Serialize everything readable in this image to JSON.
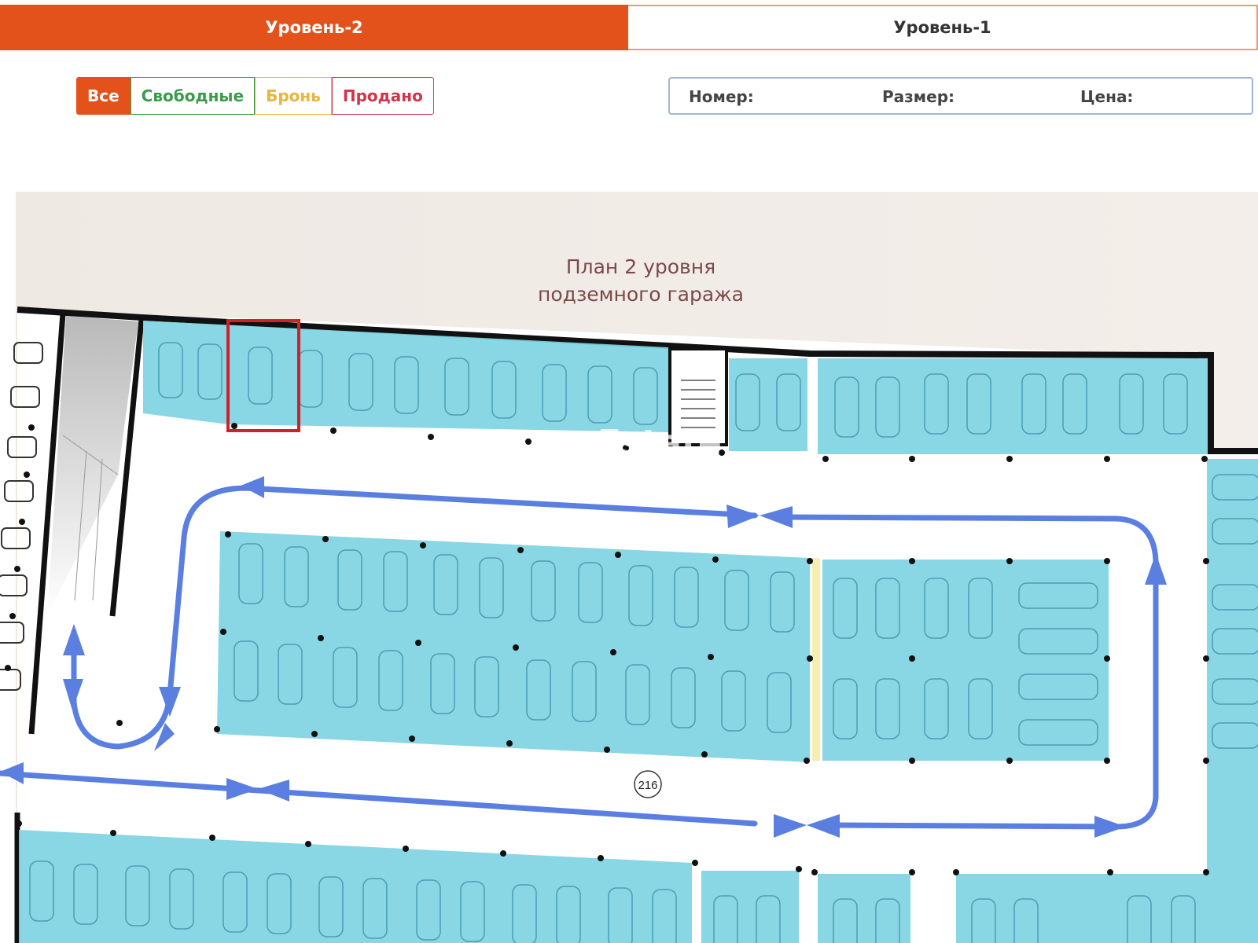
{
  "levels": {
    "active": "Уровень-2",
    "inactive": "Уровень-1"
  },
  "filters": {
    "all": "Все",
    "free": "Свободные",
    "reserved": "Бронь",
    "sold": "Продано"
  },
  "info": {
    "number_label": "Номер:",
    "size_label": "Размер:",
    "price_label": "Цена:"
  },
  "plan": {
    "title_line1": "План 2 уровня",
    "title_line2": "подземного гаража",
    "marker_number": "216",
    "watermark": "Estate"
  },
  "colors": {
    "accent": "#e4521b",
    "free": "#3a9b4b",
    "reserved": "#e8b63a",
    "sold": "#d2344a",
    "spot": "#7fd3e3",
    "route": "#5a7fe0",
    "selected": "#d2202a"
  }
}
